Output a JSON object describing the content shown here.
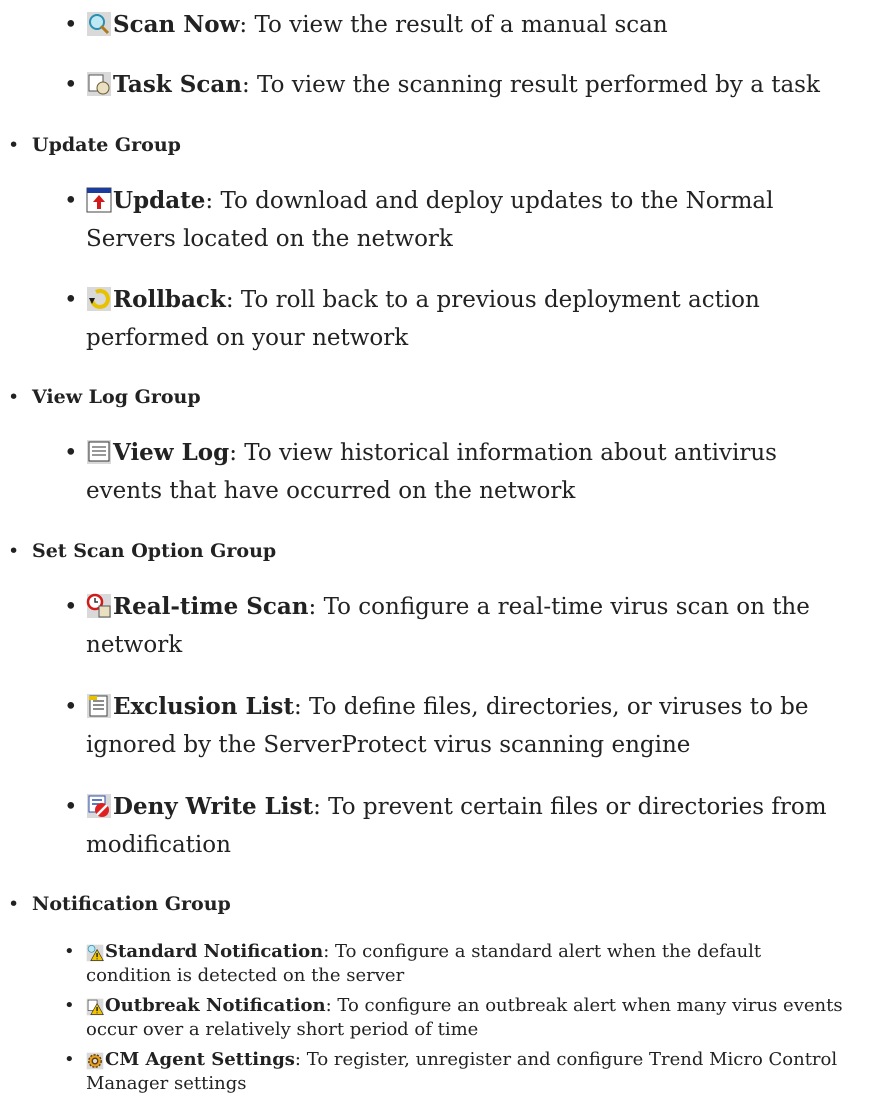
{
  "intro_items": [
    {
      "icon": "scan-now-icon",
      "name": "Scan Now",
      "sep": ":",
      "desc": " To view the result of a manual scan"
    },
    {
      "icon": "task-scan-icon",
      "name": "Task Scan",
      "sep": ":",
      "desc": " To view the scanning result performed by a task"
    }
  ],
  "groups": [
    {
      "label": "Update Group",
      "items": [
        {
          "icon": "update-icon",
          "name": "Update",
          "sep": ":",
          "desc": " To download and deploy updates to the Normal Servers located on the network"
        },
        {
          "icon": "rollback-icon",
          "name": "Rollback",
          "sep": ":",
          "desc": " To roll back to a previous deployment action performed on your network"
        }
      ]
    },
    {
      "label": "View Log Group",
      "items": [
        {
          "icon": "view-log-icon",
          "name": "View Log",
          "sep": ":",
          "desc": " To view historical information about antivirus events that have occurred on the network"
        }
      ]
    },
    {
      "label": "Set Scan Option Group",
      "items": [
        {
          "icon": "real-time-scan-icon",
          "name": "Real-time Scan",
          "sep": ":",
          "desc": " To configure a real-time virus scan on the network"
        },
        {
          "icon": "exclusion-list-icon",
          "name": "Exclusion List",
          "sep": ":",
          "desc": " To define files, directories, or viruses to be ignored by the ServerProtect virus scanning engine"
        },
        {
          "icon": "deny-write-list-icon",
          "name": "Deny Write List",
          "sep": ":",
          "desc": " To prevent certain files or directories from modification"
        }
      ]
    },
    {
      "label": "Notification Group",
      "items": [
        {
          "icon": "standard-notification-icon",
          "name": "Standard Notification",
          "sep": ":",
          "desc": " To configure a standard alert when the default condition is detected on the server"
        },
        {
          "icon": "outbreak-notification-icon",
          "name": "Outbreak Notification",
          "sep": ":",
          "desc": " To configure an outbreak alert when many virus events occur over a relatively short period of time"
        },
        {
          "icon": "cm-agent-settings-icon",
          "name": "CM Agent Settings",
          "sep": ":",
          "desc": " To register, unregister and configure Trend Micro Control Manager settings"
        }
      ]
    }
  ]
}
